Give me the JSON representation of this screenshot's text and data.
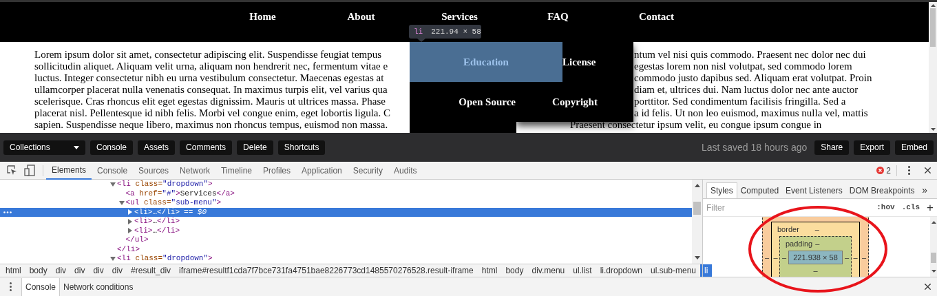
{
  "page": {
    "nav": [
      {
        "label": "Home"
      },
      {
        "label": "About"
      },
      {
        "label": "Services"
      },
      {
        "label": "FAQ"
      },
      {
        "label": "Contact"
      }
    ],
    "paragraph_left": [
      "Lorem ipsum dolor sit amet, consectetur adipiscing elit. Suspendisse feugiat tempus",
      "sollicitudin aliquet. Aliquam velit urna, aliquam non hendrerit nec, fermentum vitae e",
      "luctus. Integer consectetur nibh eu urna vestibulum consectetur. Maecenas egestas at",
      "ullamcorper placerat nulla venenatis consequat. In maximus turpis elit, vel varius qua",
      "scelerisque. Cras rhoncus elit eget egestas dignissim. Mauris ut ultrices massa. Phase",
      "placerat nisl. Pellentesque id nibh felis. Morbi vel congue enim, eget lobortis ligula. C",
      "sapien. Suspendisse neque libero, maximus non rhoncus tempus, euismod non massa."
    ],
    "paragraph_right": [
      "ntum vel nisi quis commodo. Praesent nec dolor nec dui",
      "egestas lorem non nisl volutpat, sed commodo lorem",
      "commodo justo dapibus sed. Aliquam erat volutpat. Proin",
      "diam et, ultrices dui. Nam luctus dolor nec ante auctor",
      "porttitor. Sed condimentum facilisis fringilla. Sed a",
      "a id felis. Ut non leo euismod, maximus nulla vel, mattis",
      "Praesent consectetur ipsum velit, eu congue ipsum congue in"
    ],
    "submenu": [
      {
        "label": "Education",
        "selected": true
      },
      {
        "label": "License",
        "selected": false
      },
      {
        "label": "Open Source",
        "selected": false
      },
      {
        "label": "Copyright",
        "selected": false
      }
    ],
    "tooltip": {
      "tag": "li",
      "size": "221.94 × 58"
    }
  },
  "toolbar": {
    "collections": "Collections",
    "buttons": [
      "Console",
      "Assets",
      "Comments",
      "Delete",
      "Shortcuts"
    ],
    "last_saved": "Last saved 18 hours ago",
    "right_buttons": [
      "Share",
      "Export",
      "Embed"
    ]
  },
  "devtools": {
    "tabs": [
      {
        "label": "Elements",
        "selected": true
      },
      {
        "label": "Console",
        "selected": false
      },
      {
        "label": "Sources",
        "selected": false
      },
      {
        "label": "Network",
        "selected": false
      },
      {
        "label": "Timeline",
        "selected": false
      },
      {
        "label": "Profiles",
        "selected": false
      },
      {
        "label": "Application",
        "selected": false
      },
      {
        "label": "Security",
        "selected": false
      },
      {
        "label": "Audits",
        "selected": false
      }
    ],
    "error_count": "2",
    "dom": [
      {
        "text": "<li class=\"dropdown\">",
        "expanded": true,
        "selected": false,
        "close": "</li>",
        "children": [
          {
            "text": "<a href=\"#\">Services</a>",
            "selected": false
          },
          {
            "text": "<ul class=\"sub-menu\">",
            "expanded": true,
            "selected": false,
            "close": "</ul>",
            "children": [
              {
                "text": "<li>…</li>",
                "expanded": false,
                "selected": true,
                "suffix": "== $0"
              },
              {
                "text": "<li>…</li>",
                "expanded": false,
                "selected": false
              },
              {
                "text": "<li>…</li>",
                "expanded": false,
                "selected": false
              }
            ]
          }
        ]
      },
      {
        "text": "<li class=\"dropdown\">",
        "expanded": true,
        "selected": false
      }
    ],
    "breadcrumbs": [
      {
        "label": "html",
        "selected": false
      },
      {
        "label": "body",
        "selected": false
      },
      {
        "label": "div",
        "selected": false
      },
      {
        "label": "div",
        "selected": false
      },
      {
        "label": "div",
        "selected": false
      },
      {
        "label": "div",
        "selected": false
      },
      {
        "label": "#result_div",
        "selected": false
      },
      {
        "label": "iframe#resultf1cda7f7bce731fa4751bae8226773cd1485570276528.result-iframe",
        "selected": false
      },
      {
        "label": "html",
        "selected": false
      },
      {
        "label": "body",
        "selected": false
      },
      {
        "label": "div.menu",
        "selected": false
      },
      {
        "label": "ul.list",
        "selected": false
      },
      {
        "label": "li.dropdown",
        "selected": false
      },
      {
        "label": "ul.sub-menu",
        "selected": false
      },
      {
        "label": "li",
        "selected": true
      }
    ],
    "side_tabs": [
      {
        "label": "Styles",
        "selected": true
      },
      {
        "label": "Computed",
        "selected": false
      },
      {
        "label": "Event Listeners",
        "selected": false
      },
      {
        "label": "DOM Breakpoints",
        "selected": false
      }
    ],
    "side_more": "»",
    "filter": {
      "placeholder": "Filter",
      "hov": ":hov",
      "cls": ".cls",
      "add": "+"
    },
    "box_model": {
      "margin": {
        "left": "–",
        "right": "–"
      },
      "border": {
        "label": "border",
        "top": "–",
        "left": "–",
        "right": "–"
      },
      "padding": {
        "label": "padding",
        "top": "–",
        "bottom": "–",
        "left": "–",
        "right": "–"
      },
      "content": "221.938 × 58"
    },
    "drawer_tabs": [
      {
        "label": "Console",
        "selected": true
      },
      {
        "label": "Network conditions",
        "selected": false
      }
    ]
  }
}
